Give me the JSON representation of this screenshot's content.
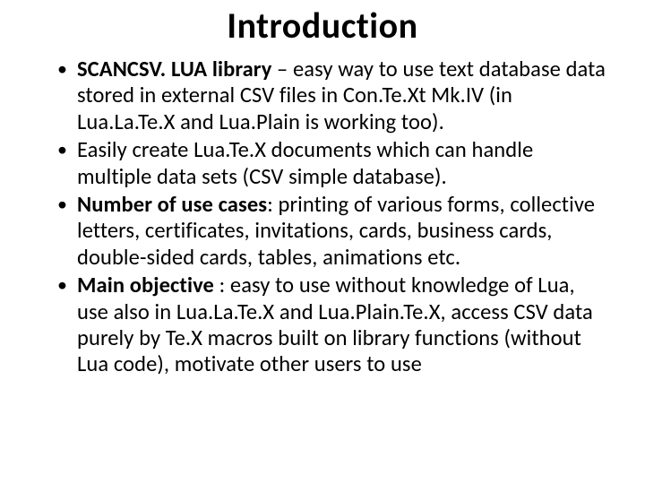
{
  "title": "Introduction",
  "bullets": [
    {
      "bold": "SCANCSV. LUA library",
      "rest": " – easy way to use text database data stored in external CSV files in Con.Te.Xt Mk.IV (in Lua.La.Te.X and Lua.Plain is working too)."
    },
    {
      "bold": "",
      "rest": "Easily create Lua.Te.X documents which can handle multiple data sets (CSV simple database)."
    },
    {
      "bold": "Number of use cases",
      "rest": ": printing of various forms, collective letters, certificates, invitations, cards, business cards, double-sided cards, tables, animations etc."
    },
    {
      "bold": "Main objective ",
      "rest": ": easy to use without knowledge of Lua, use also in Lua.La.Te.X  and Lua.Plain.Te.X, access CSV data purely by Te.X macros built on library functions (without Lua code), motivate other users to use"
    }
  ]
}
